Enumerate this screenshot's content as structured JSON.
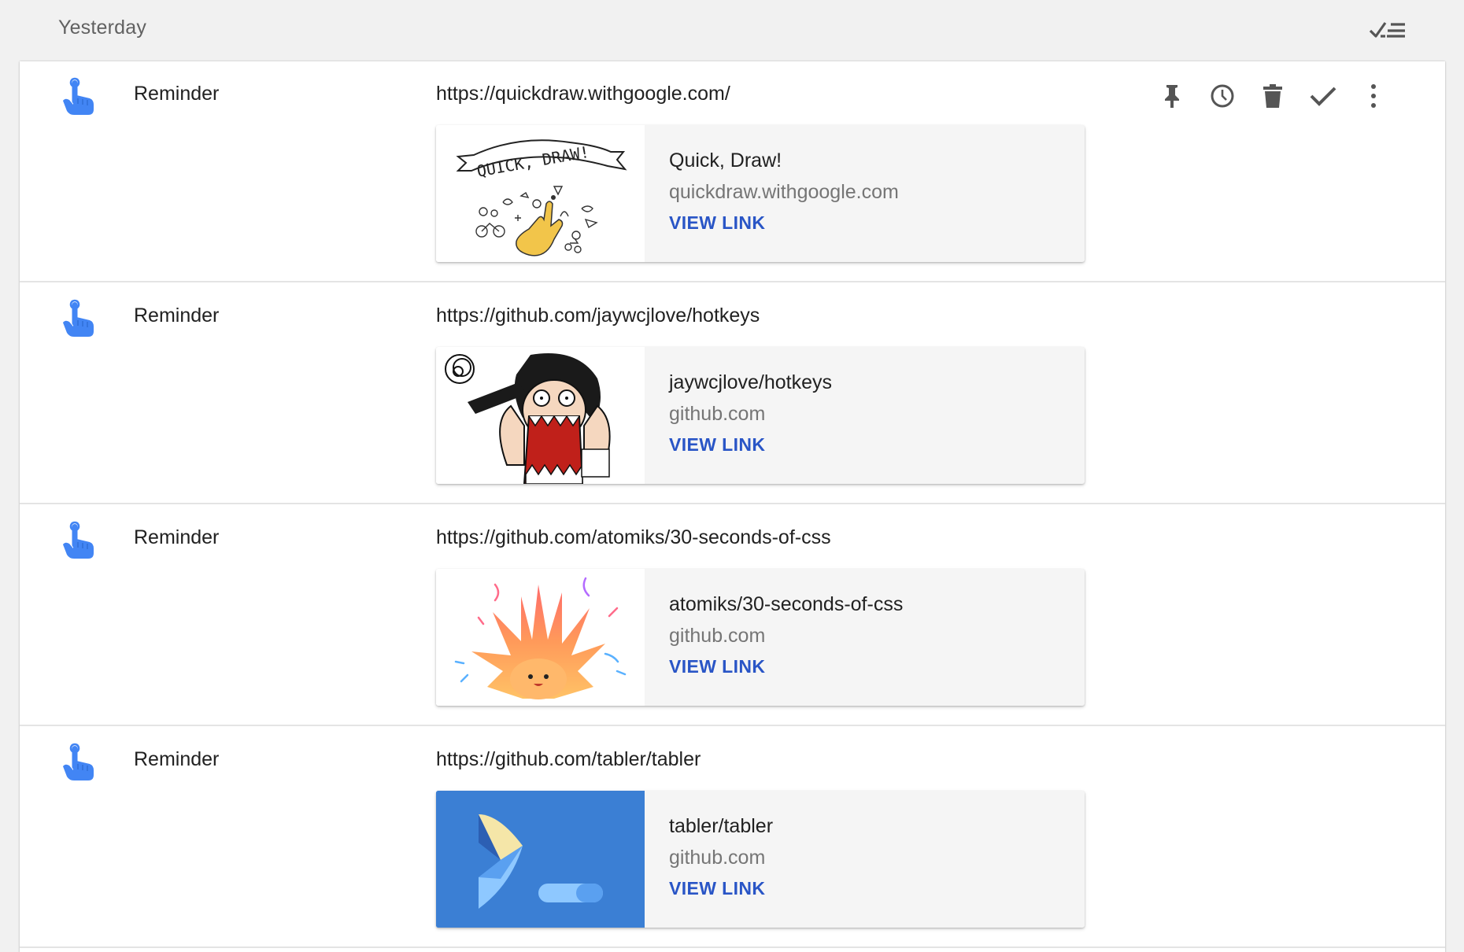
{
  "section": {
    "title": "Yesterday",
    "mark_all_done_icon": "done-all-icon"
  },
  "toolbar_icons": [
    "pin-icon",
    "snooze-clock-icon",
    "trash-icon",
    "check-icon",
    "more-vert-icon"
  ],
  "colors": {
    "accent_blue": "#4285f4",
    "link_blue": "#2955c6",
    "icon_grey": "#555555",
    "tabler_bg": "#3b7fd4"
  },
  "items": [
    {
      "type": "Reminder",
      "icon": "reminder-finger-icon",
      "url": "https://quickdraw.withgoogle.com/",
      "card": {
        "title": "Quick, Draw!",
        "domain": "quickdraw.withgoogle.com",
        "link_label": "VIEW LINK",
        "thumb_text": "QUICK, DRAW!"
      }
    },
    {
      "type": "Reminder",
      "icon": "reminder-finger-icon",
      "url": "https://github.com/jaywcjlove/hotkeys",
      "card": {
        "title": "jaywcjlove/hotkeys",
        "domain": "github.com",
        "link_label": "VIEW LINK"
      }
    },
    {
      "type": "Reminder",
      "icon": "reminder-finger-icon",
      "url": "https://github.com/atomiks/30-seconds-of-css",
      "card": {
        "title": "atomiks/30-seconds-of-css",
        "domain": "github.com",
        "link_label": "VIEW LINK"
      }
    },
    {
      "type": "Reminder",
      "icon": "reminder-finger-icon",
      "url": "https://github.com/tabler/tabler",
      "card": {
        "title": "tabler/tabler",
        "domain": "github.com",
        "link_label": "VIEW LINK"
      }
    }
  ]
}
